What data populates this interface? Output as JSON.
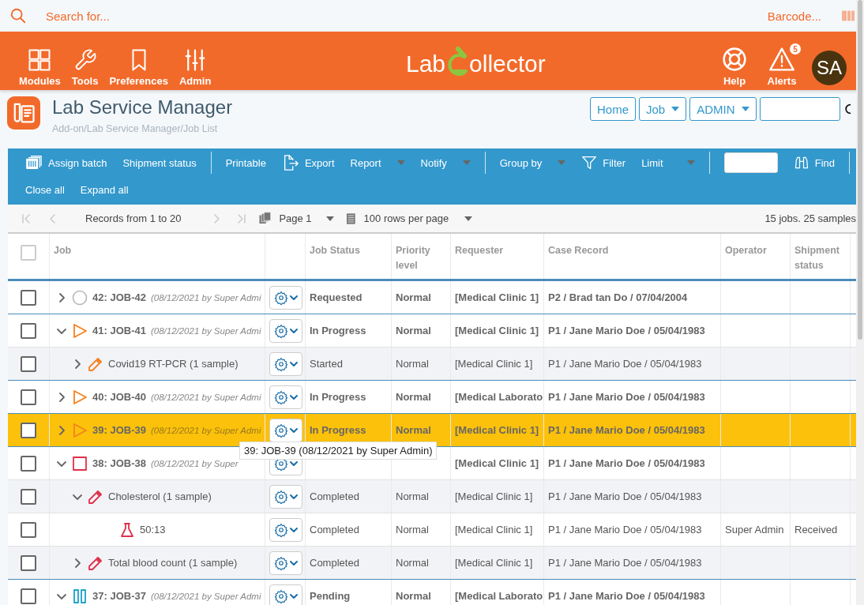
{
  "search": {
    "placeholder": "Search for...",
    "barcode_placeholder": "Barcode..."
  },
  "nav": [
    {
      "label": "Modules"
    },
    {
      "label": "Tools"
    },
    {
      "label": "Preferences"
    },
    {
      "label": "Admin"
    }
  ],
  "logo": {
    "before": "Lab",
    "after": "ollector"
  },
  "header_actions": [
    {
      "label": "Help"
    },
    {
      "label": "Alerts",
      "badge": "5"
    }
  ],
  "avatar": "SA",
  "page": {
    "title": "Lab Service Manager",
    "breadcrumb": "Add-on/Lab Service Manager/Job List"
  },
  "top_buttons": [
    {
      "label": "Home",
      "dropdown": false
    },
    {
      "label": "Job",
      "dropdown": true
    },
    {
      "label": "ADMIN",
      "dropdown": true
    }
  ],
  "toolbar": {
    "assign_batch": "Assign batch",
    "shipment_status": "Shipment status",
    "printable": "Printable",
    "export": "Export",
    "report": "Report",
    "notify": "Notify",
    "group_by": "Group by",
    "filter": "Filter",
    "limit": "Limit",
    "find": "Find",
    "close_all": "Close all",
    "expand_all": "Expand all"
  },
  "pager": {
    "records": "Records from 1 to 20",
    "page": "Page 1",
    "rows_per_page": "100 rows per page",
    "summary": "15 jobs. 25 samples"
  },
  "table": {
    "all_checked": false,
    "columns": [
      "Job",
      "Job Status",
      "Priority level",
      "Requester",
      "Case Record",
      "Operator",
      "Shipment status"
    ],
    "rows": [
      {
        "kind": "job",
        "checked": false,
        "selected": false,
        "expanded": false,
        "icon": {
          "kind": "circle",
          "color": "#b8b8b8"
        },
        "label": "42: JOB-42",
        "meta": "(08/12/2021 by Super Admi",
        "status": "Requested",
        "priority": "Normal",
        "requester": "[Medical Clinic 1]",
        "case_record": "P2 / Brad tan Do / 07/04/2004"
      },
      {
        "kind": "job",
        "checked": false,
        "selected": false,
        "expanded": true,
        "icon": {
          "kind": "triangle",
          "color": "#f58220"
        },
        "label": "41: JOB-41",
        "meta": "(08/12/2021 by Super Admi",
        "status": "In Progress",
        "priority": "Normal",
        "requester": "[Medical Clinic 1]",
        "case_record": "P1 / Jane Mario Doe / 05/04/1983",
        "children": [
          {
            "kind": "test",
            "checked": false,
            "selected": false,
            "expanded": false,
            "icon": {
              "kind": "pipette",
              "color": "#f58220"
            },
            "label": "Covid19 RT-PCR (1 sample)",
            "status": "Started",
            "priority": "Normal",
            "requester": "[Medical Clinic 1]",
            "case_record": "P1 / Jane Mario Doe / 05/04/1983"
          }
        ]
      },
      {
        "kind": "job",
        "checked": false,
        "selected": false,
        "expanded": false,
        "icon": {
          "kind": "triangle",
          "color": "#f58220"
        },
        "label": "40: JOB-40",
        "meta": "(08/12/2021 by Super Admi",
        "status": "In Progress",
        "priority": "Normal",
        "requester": "[Medical Laborato",
        "case_record": "P1 / Jane Mario Doe / 05/04/1983"
      },
      {
        "kind": "job",
        "checked": false,
        "selected": true,
        "expanded": false,
        "icon": {
          "kind": "triangle",
          "color": "#f58220"
        },
        "label": "39: JOB-39",
        "meta": "(08/12/2021 by Super Admi",
        "status": "In Progress",
        "priority": "Normal",
        "requester": "[Medical Clinic 1]",
        "case_record": "P1 / Jane Mario Doe / 05/04/1983"
      },
      {
        "kind": "job",
        "checked": false,
        "selected": false,
        "expanded": true,
        "icon": {
          "kind": "square",
          "color": "#e0304a"
        },
        "label": "38: JOB-38",
        "meta": "(08/12/2021 by Super",
        "requester": "[Medical Clinic 1]",
        "case_record": "P1 / Jane Mario Doe / 05/04/1983",
        "children": [
          {
            "kind": "test",
            "checked": false,
            "selected": false,
            "expanded": true,
            "icon": {
              "kind": "pipette",
              "color": "#e0304a"
            },
            "label": "Cholesterol (1 sample)",
            "status": "Completed",
            "priority": "Normal",
            "requester": "[Medical Clinic 1]",
            "case_record": "P1 / Jane Mario Doe / 05/04/1983",
            "children": [
              {
                "kind": "sample",
                "checked": false,
                "selected": false,
                "icon": {
                  "kind": "flask",
                  "color": "#e0304a"
                },
                "label": "50:13",
                "status": "Completed",
                "priority": "Normal",
                "requester": "[Medical Clinic 1]",
                "case_record": "P1 / Jane Mario Doe / 05/04/1983",
                "operator": "Super Admin",
                "shipment": "Received"
              }
            ]
          },
          {
            "kind": "test",
            "checked": false,
            "selected": false,
            "expanded": false,
            "icon": {
              "kind": "pipette",
              "color": "#e0304a"
            },
            "label": "Total blood count (1 sample)",
            "status": "Completed",
            "priority": "Normal",
            "requester": "[Medical Clinic 1]",
            "case_record": "P1 / Jane Mario Doe / 05/04/1983"
          }
        ]
      },
      {
        "kind": "job",
        "checked": false,
        "selected": false,
        "expanded": true,
        "icon": {
          "kind": "pause",
          "color": "#1aa3c9"
        },
        "label": "37: JOB-37",
        "meta": "(08/12/2021 by Super Admi",
        "status": "Pending",
        "priority": "Normal",
        "requester": "[Medical Laborato",
        "case_record": "P1 / Jane Mario Doe / 05/04/1983"
      }
    ]
  },
  "tooltip": "39: JOB-39 (08/12/2021 by Super Admin)"
}
